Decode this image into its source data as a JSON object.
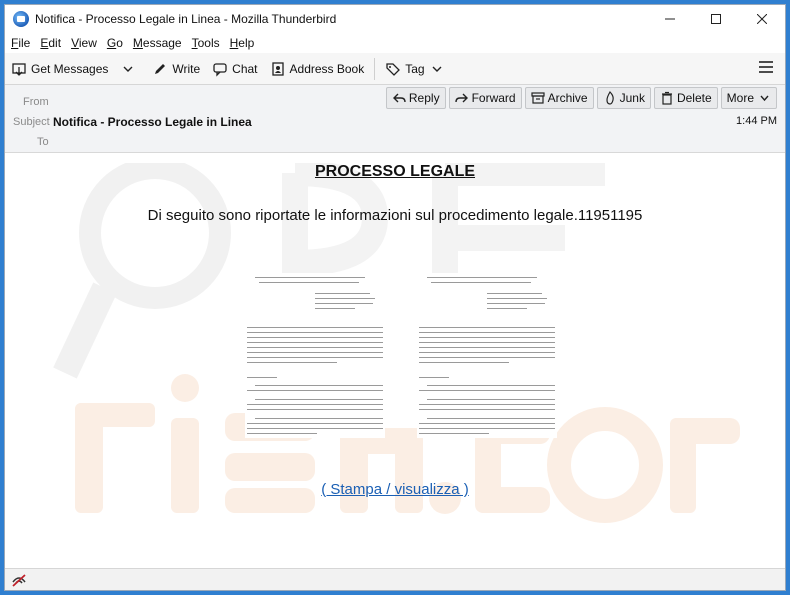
{
  "window": {
    "title": "Notifica - Processo Legale in Linea - Mozilla Thunderbird"
  },
  "menu": [
    {
      "label": "File",
      "accel": "F",
      "rest": "ile"
    },
    {
      "label": "Edit",
      "accel": "E",
      "rest": "dit"
    },
    {
      "label": "View",
      "accel": "V",
      "rest": "iew"
    },
    {
      "label": "Go",
      "accel": "G",
      "rest": "o"
    },
    {
      "label": "Message",
      "accel": "M",
      "rest": "essage"
    },
    {
      "label": "Tools",
      "accel": "T",
      "rest": "ools"
    },
    {
      "label": "Help",
      "accel": "H",
      "rest": "elp"
    }
  ],
  "toolbar": {
    "get_messages": "Get Messages",
    "write": "Write",
    "chat": "Chat",
    "address_book": "Address Book",
    "tag": "Tag"
  },
  "header": {
    "from_label": "From",
    "subject_label": "Subject",
    "to_label": "To",
    "subject": "Notifica - Processo Legale in Linea",
    "time": "1:44 PM",
    "actions": {
      "reply": "Reply",
      "forward": "Forward",
      "archive": "Archive",
      "junk": "Junk",
      "delete": "Delete",
      "more": "More"
    }
  },
  "body": {
    "heading": "PROCESSO LEGALE",
    "intro": "Di seguito sono riportate le informazioni sul procedimento legale.11951195",
    "link": "( Stampa / visualizza )"
  },
  "colors": {
    "accent": "#1a5fb4",
    "window_border": "#2f7fd0"
  }
}
